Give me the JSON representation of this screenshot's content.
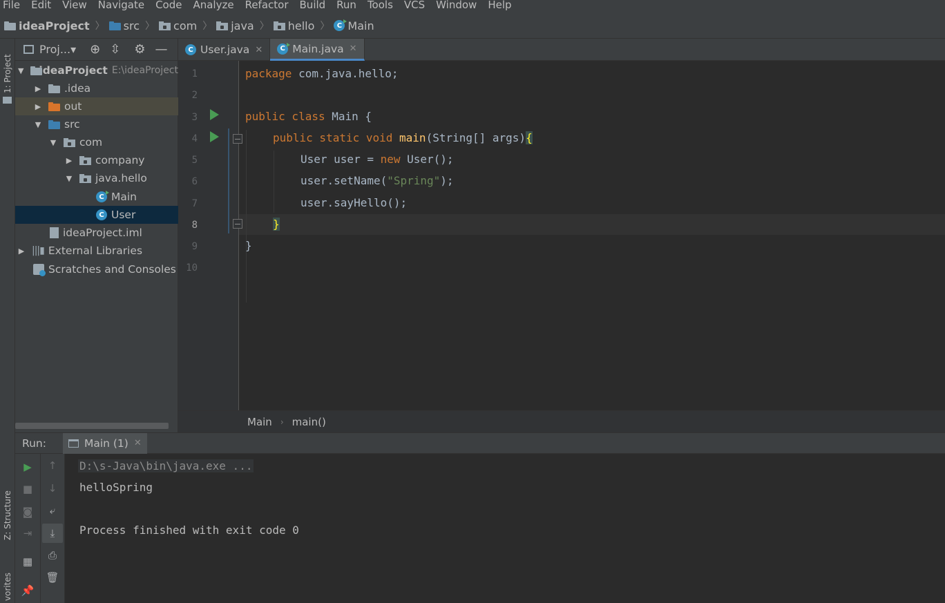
{
  "menu": [
    "File",
    "Edit",
    "View",
    "Navigate",
    "Code",
    "Analyze",
    "Refactor",
    "Build",
    "Run",
    "Tools",
    "VCS",
    "Window",
    "Help"
  ],
  "breadcrumb": [
    "ideaProject",
    "src",
    "com",
    "java",
    "hello",
    "Main"
  ],
  "left_strip": {
    "project_tab": "1: Project",
    "structure_tab": "Z: Structure",
    "favorites_tab": "vorites"
  },
  "project_panel": {
    "title": "Proj...▾",
    "tree": [
      {
        "label": "ideaProject",
        "path": "E:\\ideaProject",
        "expanded": true,
        "bold": true
      },
      {
        "label": ".idea"
      },
      {
        "label": "out"
      },
      {
        "label": "src"
      },
      {
        "label": "com"
      },
      {
        "label": "company"
      },
      {
        "label": "java.hello"
      },
      {
        "label": "Main"
      },
      {
        "label": "User"
      },
      {
        "label": "ideaProject.iml"
      },
      {
        "label": "External Libraries"
      },
      {
        "label": "Scratches and Consoles"
      }
    ]
  },
  "tabs": [
    {
      "label": "User.java",
      "active": false
    },
    {
      "label": "Main.java",
      "active": true
    }
  ],
  "code_lines": [
    "1",
    "2",
    "3",
    "4",
    "5",
    "6",
    "7",
    "8",
    "9",
    "10"
  ],
  "code": {
    "l1_kw": "package",
    "l1_rest": " com.java.hello;",
    "l3_kw": "public class",
    "l3_rest": " Main {",
    "l4_kw": "public static void",
    "l4_fn": "main",
    "l4_rest": "(String[] args)",
    "l4_brace": "{",
    "l5_a": "User user = ",
    "l5_kw": "new",
    "l5_b": " User();",
    "l6_a": "user.setName(",
    "l6_str": "\"Spring\"",
    "l6_b": ");",
    "l7": "user.sayHello();",
    "l8_brace": "}",
    "l9": "}"
  },
  "editor_breadcrumb": [
    "Main",
    "main()"
  ],
  "run_panel": {
    "label": "Run:",
    "tab": "Main (1)",
    "console": [
      "D:\\s-Java\\bin\\java.exe ...",
      "helloSpring",
      "",
      "Process finished with exit code 0"
    ]
  },
  "colors": {
    "accent": "#4a88c7",
    "selection": "#0d293e",
    "run_green": "#499c54"
  }
}
